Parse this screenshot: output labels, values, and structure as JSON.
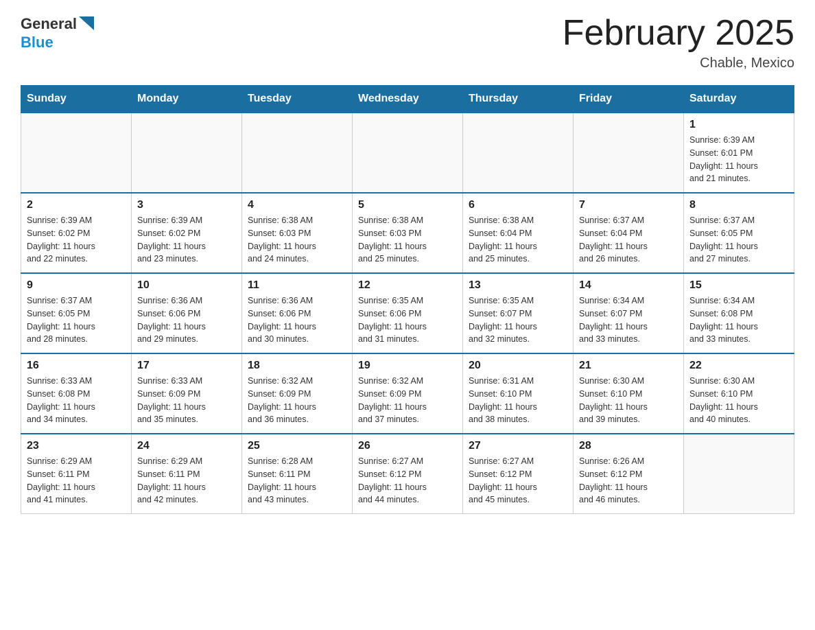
{
  "header": {
    "logo_general": "General",
    "logo_blue": "Blue",
    "month_title": "February 2025",
    "location": "Chable, Mexico"
  },
  "days_of_week": [
    "Sunday",
    "Monday",
    "Tuesday",
    "Wednesday",
    "Thursday",
    "Friday",
    "Saturday"
  ],
  "weeks": [
    [
      {
        "day": "",
        "info": ""
      },
      {
        "day": "",
        "info": ""
      },
      {
        "day": "",
        "info": ""
      },
      {
        "day": "",
        "info": ""
      },
      {
        "day": "",
        "info": ""
      },
      {
        "day": "",
        "info": ""
      },
      {
        "day": "1",
        "info": "Sunrise: 6:39 AM\nSunset: 6:01 PM\nDaylight: 11 hours\nand 21 minutes."
      }
    ],
    [
      {
        "day": "2",
        "info": "Sunrise: 6:39 AM\nSunset: 6:02 PM\nDaylight: 11 hours\nand 22 minutes."
      },
      {
        "day": "3",
        "info": "Sunrise: 6:39 AM\nSunset: 6:02 PM\nDaylight: 11 hours\nand 23 minutes."
      },
      {
        "day": "4",
        "info": "Sunrise: 6:38 AM\nSunset: 6:03 PM\nDaylight: 11 hours\nand 24 minutes."
      },
      {
        "day": "5",
        "info": "Sunrise: 6:38 AM\nSunset: 6:03 PM\nDaylight: 11 hours\nand 25 minutes."
      },
      {
        "day": "6",
        "info": "Sunrise: 6:38 AM\nSunset: 6:04 PM\nDaylight: 11 hours\nand 25 minutes."
      },
      {
        "day": "7",
        "info": "Sunrise: 6:37 AM\nSunset: 6:04 PM\nDaylight: 11 hours\nand 26 minutes."
      },
      {
        "day": "8",
        "info": "Sunrise: 6:37 AM\nSunset: 6:05 PM\nDaylight: 11 hours\nand 27 minutes."
      }
    ],
    [
      {
        "day": "9",
        "info": "Sunrise: 6:37 AM\nSunset: 6:05 PM\nDaylight: 11 hours\nand 28 minutes."
      },
      {
        "day": "10",
        "info": "Sunrise: 6:36 AM\nSunset: 6:06 PM\nDaylight: 11 hours\nand 29 minutes."
      },
      {
        "day": "11",
        "info": "Sunrise: 6:36 AM\nSunset: 6:06 PM\nDaylight: 11 hours\nand 30 minutes."
      },
      {
        "day": "12",
        "info": "Sunrise: 6:35 AM\nSunset: 6:06 PM\nDaylight: 11 hours\nand 31 minutes."
      },
      {
        "day": "13",
        "info": "Sunrise: 6:35 AM\nSunset: 6:07 PM\nDaylight: 11 hours\nand 32 minutes."
      },
      {
        "day": "14",
        "info": "Sunrise: 6:34 AM\nSunset: 6:07 PM\nDaylight: 11 hours\nand 33 minutes."
      },
      {
        "day": "15",
        "info": "Sunrise: 6:34 AM\nSunset: 6:08 PM\nDaylight: 11 hours\nand 33 minutes."
      }
    ],
    [
      {
        "day": "16",
        "info": "Sunrise: 6:33 AM\nSunset: 6:08 PM\nDaylight: 11 hours\nand 34 minutes."
      },
      {
        "day": "17",
        "info": "Sunrise: 6:33 AM\nSunset: 6:09 PM\nDaylight: 11 hours\nand 35 minutes."
      },
      {
        "day": "18",
        "info": "Sunrise: 6:32 AM\nSunset: 6:09 PM\nDaylight: 11 hours\nand 36 minutes."
      },
      {
        "day": "19",
        "info": "Sunrise: 6:32 AM\nSunset: 6:09 PM\nDaylight: 11 hours\nand 37 minutes."
      },
      {
        "day": "20",
        "info": "Sunrise: 6:31 AM\nSunset: 6:10 PM\nDaylight: 11 hours\nand 38 minutes."
      },
      {
        "day": "21",
        "info": "Sunrise: 6:30 AM\nSunset: 6:10 PM\nDaylight: 11 hours\nand 39 minutes."
      },
      {
        "day": "22",
        "info": "Sunrise: 6:30 AM\nSunset: 6:10 PM\nDaylight: 11 hours\nand 40 minutes."
      }
    ],
    [
      {
        "day": "23",
        "info": "Sunrise: 6:29 AM\nSunset: 6:11 PM\nDaylight: 11 hours\nand 41 minutes."
      },
      {
        "day": "24",
        "info": "Sunrise: 6:29 AM\nSunset: 6:11 PM\nDaylight: 11 hours\nand 42 minutes."
      },
      {
        "day": "25",
        "info": "Sunrise: 6:28 AM\nSunset: 6:11 PM\nDaylight: 11 hours\nand 43 minutes."
      },
      {
        "day": "26",
        "info": "Sunrise: 6:27 AM\nSunset: 6:12 PM\nDaylight: 11 hours\nand 44 minutes."
      },
      {
        "day": "27",
        "info": "Sunrise: 6:27 AM\nSunset: 6:12 PM\nDaylight: 11 hours\nand 45 minutes."
      },
      {
        "day": "28",
        "info": "Sunrise: 6:26 AM\nSunset: 6:12 PM\nDaylight: 11 hours\nand 46 minutes."
      },
      {
        "day": "",
        "info": ""
      }
    ]
  ]
}
